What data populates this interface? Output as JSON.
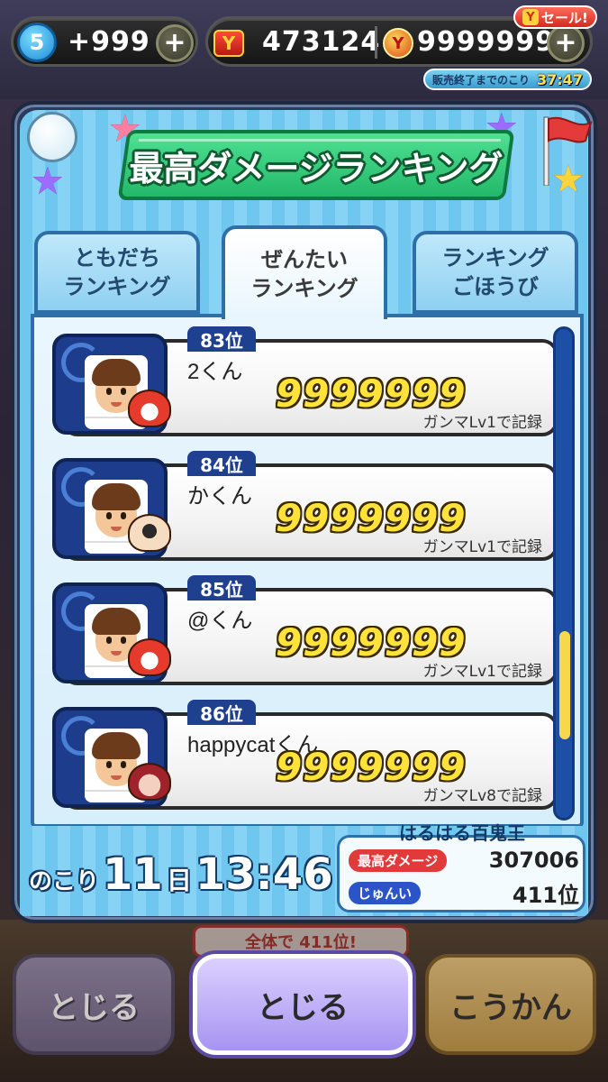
{
  "topbar": {
    "stamina_level": "5",
    "stamina_value": "+999",
    "coins": "473124",
    "gems": "9999999",
    "sale_label": "セール!",
    "sale_timer_label": "販売終了までのこり",
    "sale_timer": "37:47"
  },
  "panel": {
    "title": "最高ダメージランキング"
  },
  "tabs": [
    {
      "line1": "ともだち",
      "line2": "ランキング",
      "active": false
    },
    {
      "line1": "ぜんたい",
      "line2": "ランキング",
      "active": true
    },
    {
      "line1": "ランキング",
      "line2": "ごほうび",
      "active": false
    }
  ],
  "rankings": [
    {
      "rank": "83位",
      "name": "2くん",
      "score": "9999999",
      "record": "ガンマLv1で記録",
      "yokai": "red-cat-yokai"
    },
    {
      "rank": "84位",
      "name": "かくん",
      "score": "9999999",
      "record": "ガンマLv1で記録",
      "yokai": "round-face-yokai"
    },
    {
      "rank": "85位",
      "name": "@くん",
      "score": "9999999",
      "record": "ガンマLv1で記録",
      "yokai": "red-cat-yokai"
    },
    {
      "rank": "86位",
      "name": "happycatくん",
      "score": "9999999",
      "record": "ガンマLv8で記録",
      "yokai": "mask-yokai"
    }
  ],
  "scrollbar": {
    "position": 0.8
  },
  "remaining": {
    "label": "のこり",
    "days": "11",
    "days_unit": "日",
    "time": "13:46"
  },
  "my_info": {
    "title": "はるはる百鬼王",
    "damage_label": "最高ダメージ",
    "damage_value": "307006",
    "rank_label": "じゅんい",
    "rank_value": "411位"
  },
  "background_banner": "全体で 411位!",
  "buttons": {
    "left": "とじる",
    "center": "とじる",
    "right": "こうかん"
  },
  "colors": {
    "accent_green": "#23b86a",
    "score_yellow": "#ffe23a",
    "panel_blue": "#6fc7f0",
    "rank_tab": "#1f3f8f"
  }
}
